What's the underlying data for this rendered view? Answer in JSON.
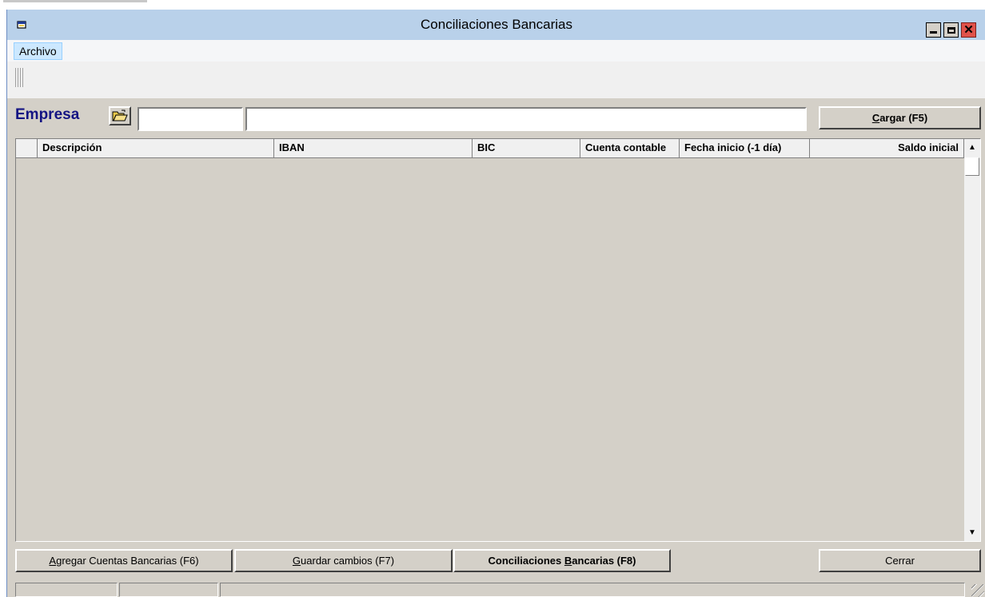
{
  "window": {
    "title": "Conciliaciones Bancarias"
  },
  "menu": {
    "archivo": "Archivo"
  },
  "empresa": {
    "label": "Empresa",
    "code_value": "",
    "name_value": ""
  },
  "buttons": {
    "cargar_hotkey": "C",
    "cargar_rest": "argar (F5)",
    "agregar_hotkey": "A",
    "agregar_rest": "gregar Cuentas Bancarias (F6)",
    "guardar_hotkey": "G",
    "guardar_rest": "uardar cambios (F7)",
    "concil_pre": "Conciliaciones ",
    "concil_hotkey": "B",
    "concil_rest": "ancarias (F8)",
    "cerrar": "Cerrar"
  },
  "grid": {
    "columns": [
      "Descripción",
      "IBAN",
      "BIC",
      "Cuenta contable",
      "Fecha inicio (-1 día)",
      "Saldo inicial"
    ],
    "rows": []
  },
  "icons": {
    "app": "window-app-icon",
    "folder": "open-folder-icon",
    "minimize": "minimize-icon",
    "maximize": "maximize-icon",
    "close": "close-icon"
  },
  "colors": {
    "titlebar": "#b9d1ea",
    "empresa_label": "#141483",
    "close_button": "#e0524a",
    "surface": "#d4d0c8"
  }
}
